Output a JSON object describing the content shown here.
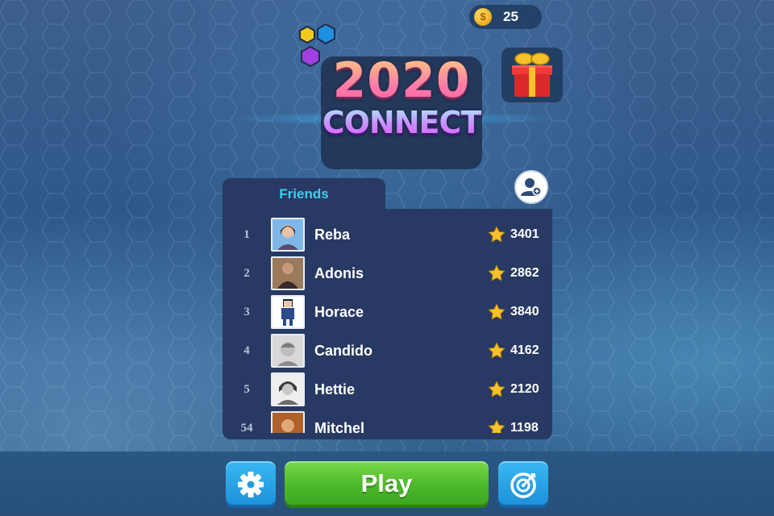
{
  "wallet": {
    "coins": "25",
    "coin_symbol": "$"
  },
  "logo": {
    "year": "2020",
    "word": "CONNECT"
  },
  "leaderboard": {
    "tab_label": "Friends",
    "rows": [
      {
        "rank": "1",
        "name": "Reba",
        "score": "3401"
      },
      {
        "rank": "2",
        "name": "Adonis",
        "score": "2862"
      },
      {
        "rank": "3",
        "name": "Horace",
        "score": "3840"
      },
      {
        "rank": "4",
        "name": "Candido",
        "score": "4162"
      },
      {
        "rank": "5",
        "name": "Hettie",
        "score": "2120"
      },
      {
        "rank": "54",
        "name": "Mitchel",
        "score": "1198"
      }
    ]
  },
  "buttons": {
    "play_label": "Play"
  },
  "icons": {
    "coin": "coin-icon",
    "gift": "gift-icon",
    "add_friend": "add-friend-icon",
    "star": "star-icon",
    "settings": "gear-icon",
    "target": "target-icon"
  },
  "colors": {
    "accent_tab": "#3ad0f0",
    "play_green": "#4ab82a",
    "button_blue": "#1b8fd8",
    "panel": "#283a63"
  }
}
